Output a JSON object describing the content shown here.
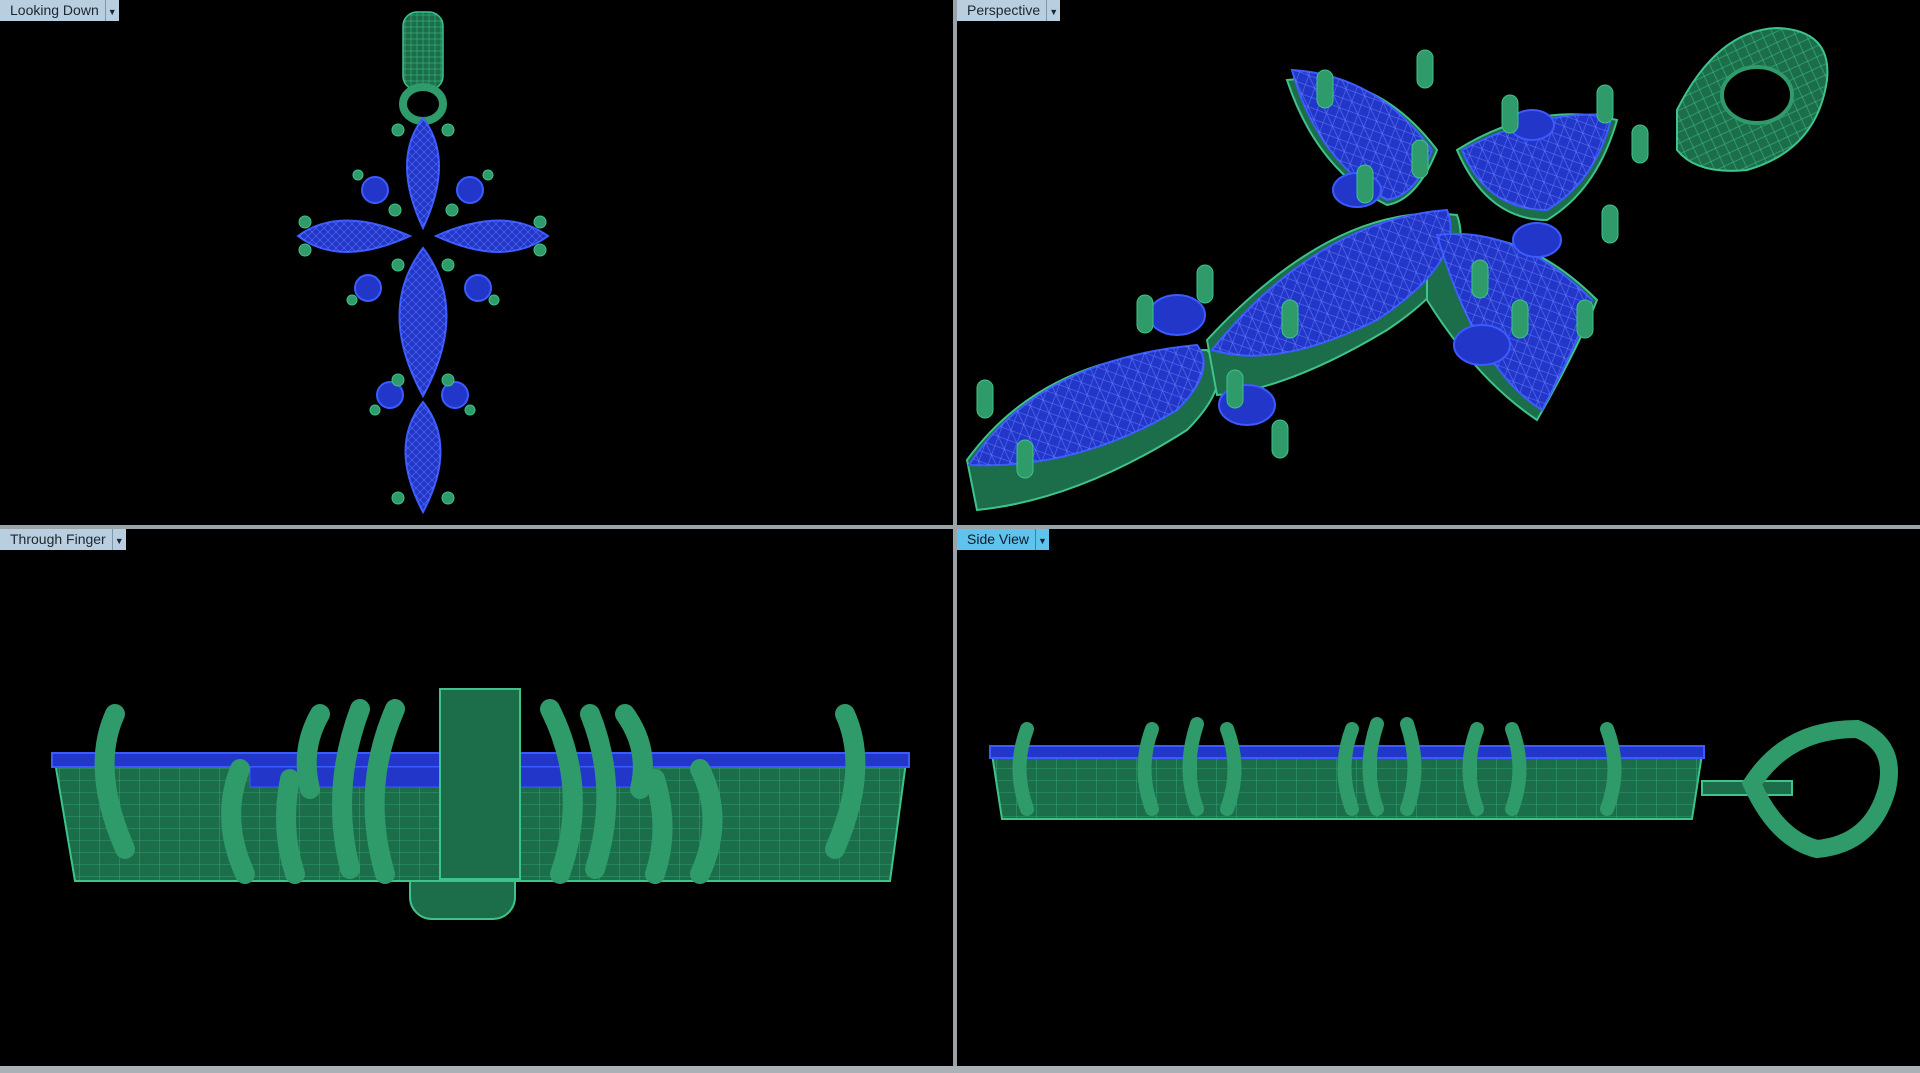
{
  "viewports": {
    "top_left": {
      "label": "Looking Down",
      "active": false
    },
    "top_right": {
      "label": "Perspective",
      "active": false
    },
    "bottom_left": {
      "label": "Through Finger",
      "active": false
    },
    "bottom_right": {
      "label": "Side View",
      "active": true
    }
  },
  "icons": {
    "viewport_menu": "chevron-down-icon"
  },
  "colors": {
    "background": "#000000",
    "metal_wire": "#2f9a6a",
    "metal_fill": "#1c6e4b",
    "gem_wire": "#3b5bff",
    "gem_fill": "#2236c9",
    "active_label": "#5fc3ee",
    "inactive_label": "#b9cfe0",
    "divider": "#9aa3a8"
  }
}
